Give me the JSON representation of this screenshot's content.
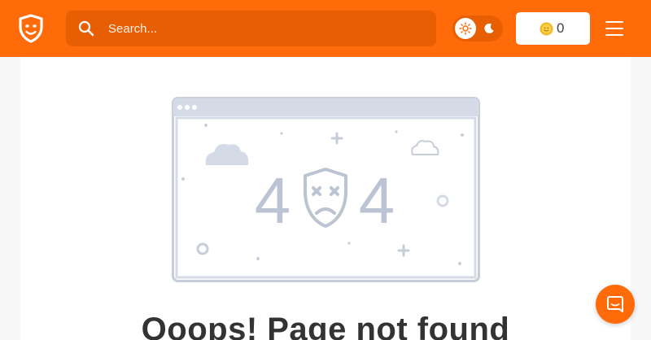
{
  "header": {
    "search": {
      "placeholder": "Search...",
      "icon": "search-icon"
    },
    "theme_toggle": {
      "active": "light",
      "light_icon": "sun-icon",
      "dark_icon": "moon-icon"
    },
    "coins": {
      "count": "0",
      "icon": "coin-icon"
    },
    "menu_icon": "hamburger-icon"
  },
  "error": {
    "code_left": "4",
    "code_right": "4",
    "heading": "Ooops! Page not found"
  },
  "chat_icon": "chat-bubble-icon",
  "colors": {
    "brand": "#ff6b08",
    "brand_dark": "#e85e02",
    "illustration": "#bcc4d3",
    "illustration_fill": "#d5dbe6",
    "text": "#333333"
  }
}
